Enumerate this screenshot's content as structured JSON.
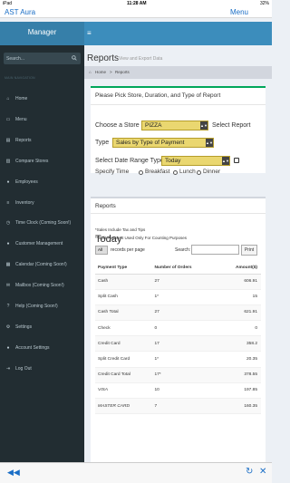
{
  "status": {
    "device": "iPad",
    "time": "11:28 AM",
    "battery": "32%"
  },
  "app": {
    "title": "AST Aura",
    "menu_label": "Menu"
  },
  "sidebar": {
    "brand": "Manager",
    "search_placeholder": "Search...",
    "section_header": "MAIN NAVIGATION",
    "items": [
      {
        "label": "Home",
        "icon": "home-icon",
        "glyph": "⌂"
      },
      {
        "label": "Menu",
        "icon": "book-icon",
        "glyph": "▭"
      },
      {
        "label": "Reports",
        "icon": "file-icon",
        "glyph": "▤"
      },
      {
        "label": "Compare Stores",
        "icon": "compare-icon",
        "glyph": "▥"
      },
      {
        "label": "Employees",
        "icon": "users-icon",
        "glyph": "●"
      },
      {
        "label": "Inventory",
        "icon": "list-icon",
        "glyph": "≡"
      },
      {
        "label": "Time Clock (Coming Soon!)",
        "icon": "clock-icon",
        "glyph": "◷"
      },
      {
        "label": "Customer Management",
        "icon": "customer-icon",
        "glyph": "●"
      },
      {
        "label": "Calendar (Coming Soon!)",
        "icon": "calendar-icon",
        "glyph": "▦"
      },
      {
        "label": "Mailbox (Coming Soon!)",
        "icon": "mail-icon",
        "glyph": "✉"
      },
      {
        "label": "Help (Coming Soon!)",
        "icon": "help-icon",
        "glyph": "?"
      },
      {
        "label": "Settings",
        "icon": "gear-icon",
        "glyph": "⚙"
      },
      {
        "label": "Account Settings",
        "icon": "user-icon",
        "glyph": "●"
      },
      {
        "label": "Log Out",
        "icon": "logout-icon",
        "glyph": "⇥"
      }
    ]
  },
  "header": {
    "toggle_glyph": "≡"
  },
  "page": {
    "title": "Reports",
    "subtitle": "View and Export Data",
    "breadcrumb_home": "Home",
    "breadcrumb_sep": ">",
    "breadcrumb_current": "Reports"
  },
  "form": {
    "heading": "Please Pick Store, Duration, and Type of Report",
    "choose_store_label": "Choose a Store",
    "store_value": "PIZZA",
    "select_report_label": "Select Report",
    "type_label": "Type",
    "type_value": "Sales by Type of Payment",
    "date_range_label": "Select Date Range Type",
    "date_range_value": "Today",
    "specify_time_label": "Specify Time",
    "time_options": [
      "Breakfast",
      "Lunch",
      "Dinner"
    ]
  },
  "report": {
    "box_title": "Reports",
    "period": "Today",
    "note1": "*Sales Include Tax and Tips",
    "note2": "**Split Payment Used Only For Counting Purposes",
    "length_value": "All",
    "length_label": "records per page",
    "search_label": "Search:",
    "print_label": "Print",
    "columns": [
      "Payment Type",
      "Number of Orders",
      "Amount($)"
    ],
    "rows": [
      {
        "type": "Cash",
        "orders": "27",
        "amount": "606.91",
        "italic": false
      },
      {
        "type": "Split Cash",
        "orders": "1*",
        "amount": "15",
        "italic": false
      },
      {
        "type": "Cash Total",
        "orders": "27",
        "amount": "621.91",
        "italic": false
      },
      {
        "type": "Check",
        "orders": "0",
        "amount": "0",
        "italic": false
      },
      {
        "type": "Credit Card",
        "orders": "17",
        "amount": "358.2",
        "italic": false
      },
      {
        "type": "Split Credit Card",
        "orders": "1*",
        "amount": "20.35",
        "italic": false
      },
      {
        "type": "Credit Card Total",
        "orders": "17*",
        "amount": "378.55",
        "italic": false
      },
      {
        "type": "VISA",
        "orders": "10",
        "amount": "197.85",
        "italic": true
      },
      {
        "type": "MASTER CARD",
        "orders": "7",
        "amount": "160.35",
        "italic": true
      }
    ]
  },
  "browser": {
    "back_glyph": "◀◀",
    "reload_glyph": "↻",
    "close_glyph": "✕"
  },
  "colors": {
    "sidebar": "#222d32",
    "header": "#3c8dbc",
    "brand": "#367fa9",
    "select": "#ead770",
    "accent_green": "#00a65a",
    "link": "#1a6ec6"
  }
}
